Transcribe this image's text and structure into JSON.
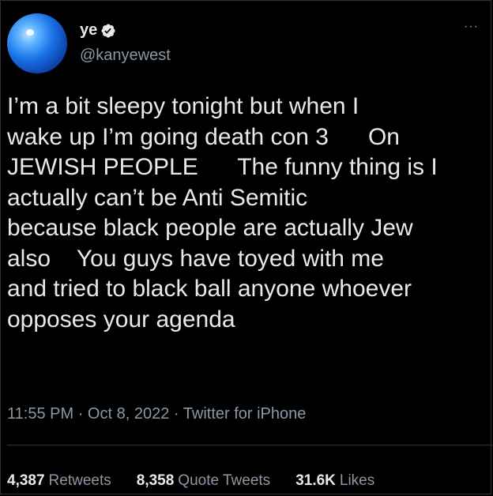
{
  "user": {
    "name": "ye",
    "handle": "@kanyewest"
  },
  "tweet": {
    "text": "I’m a bit sleepy tonight but when I\nwake up I’m going death con 3      On\nJEWISH PEOPLE      The funny thing is I\nactually can’t be Anti Semitic\nbecause black people are actually Jew\nalso    You guys have toyed with me\nand tried to black ball anyone whoever\nopposes your agenda",
    "time": "11:55 PM",
    "date": "Oct 8, 2022",
    "source": "Twitter for iPhone",
    "sep": "·"
  },
  "stats": {
    "retweets_count": "4,387",
    "retweets_label": "Retweets",
    "quotes_count": "8,358",
    "quotes_label": "Quote Tweets",
    "likes_count": "31.6K",
    "likes_label": "Likes"
  },
  "icons": {
    "more": "more-icon",
    "verified": "verified-badge-icon",
    "avatar": "globe-avatar"
  },
  "colors": {
    "background": "#000000",
    "text": "#e7e9ea",
    "secondary": "#8b98a5",
    "divider": "#2f3336"
  },
  "more_glyph": "···"
}
